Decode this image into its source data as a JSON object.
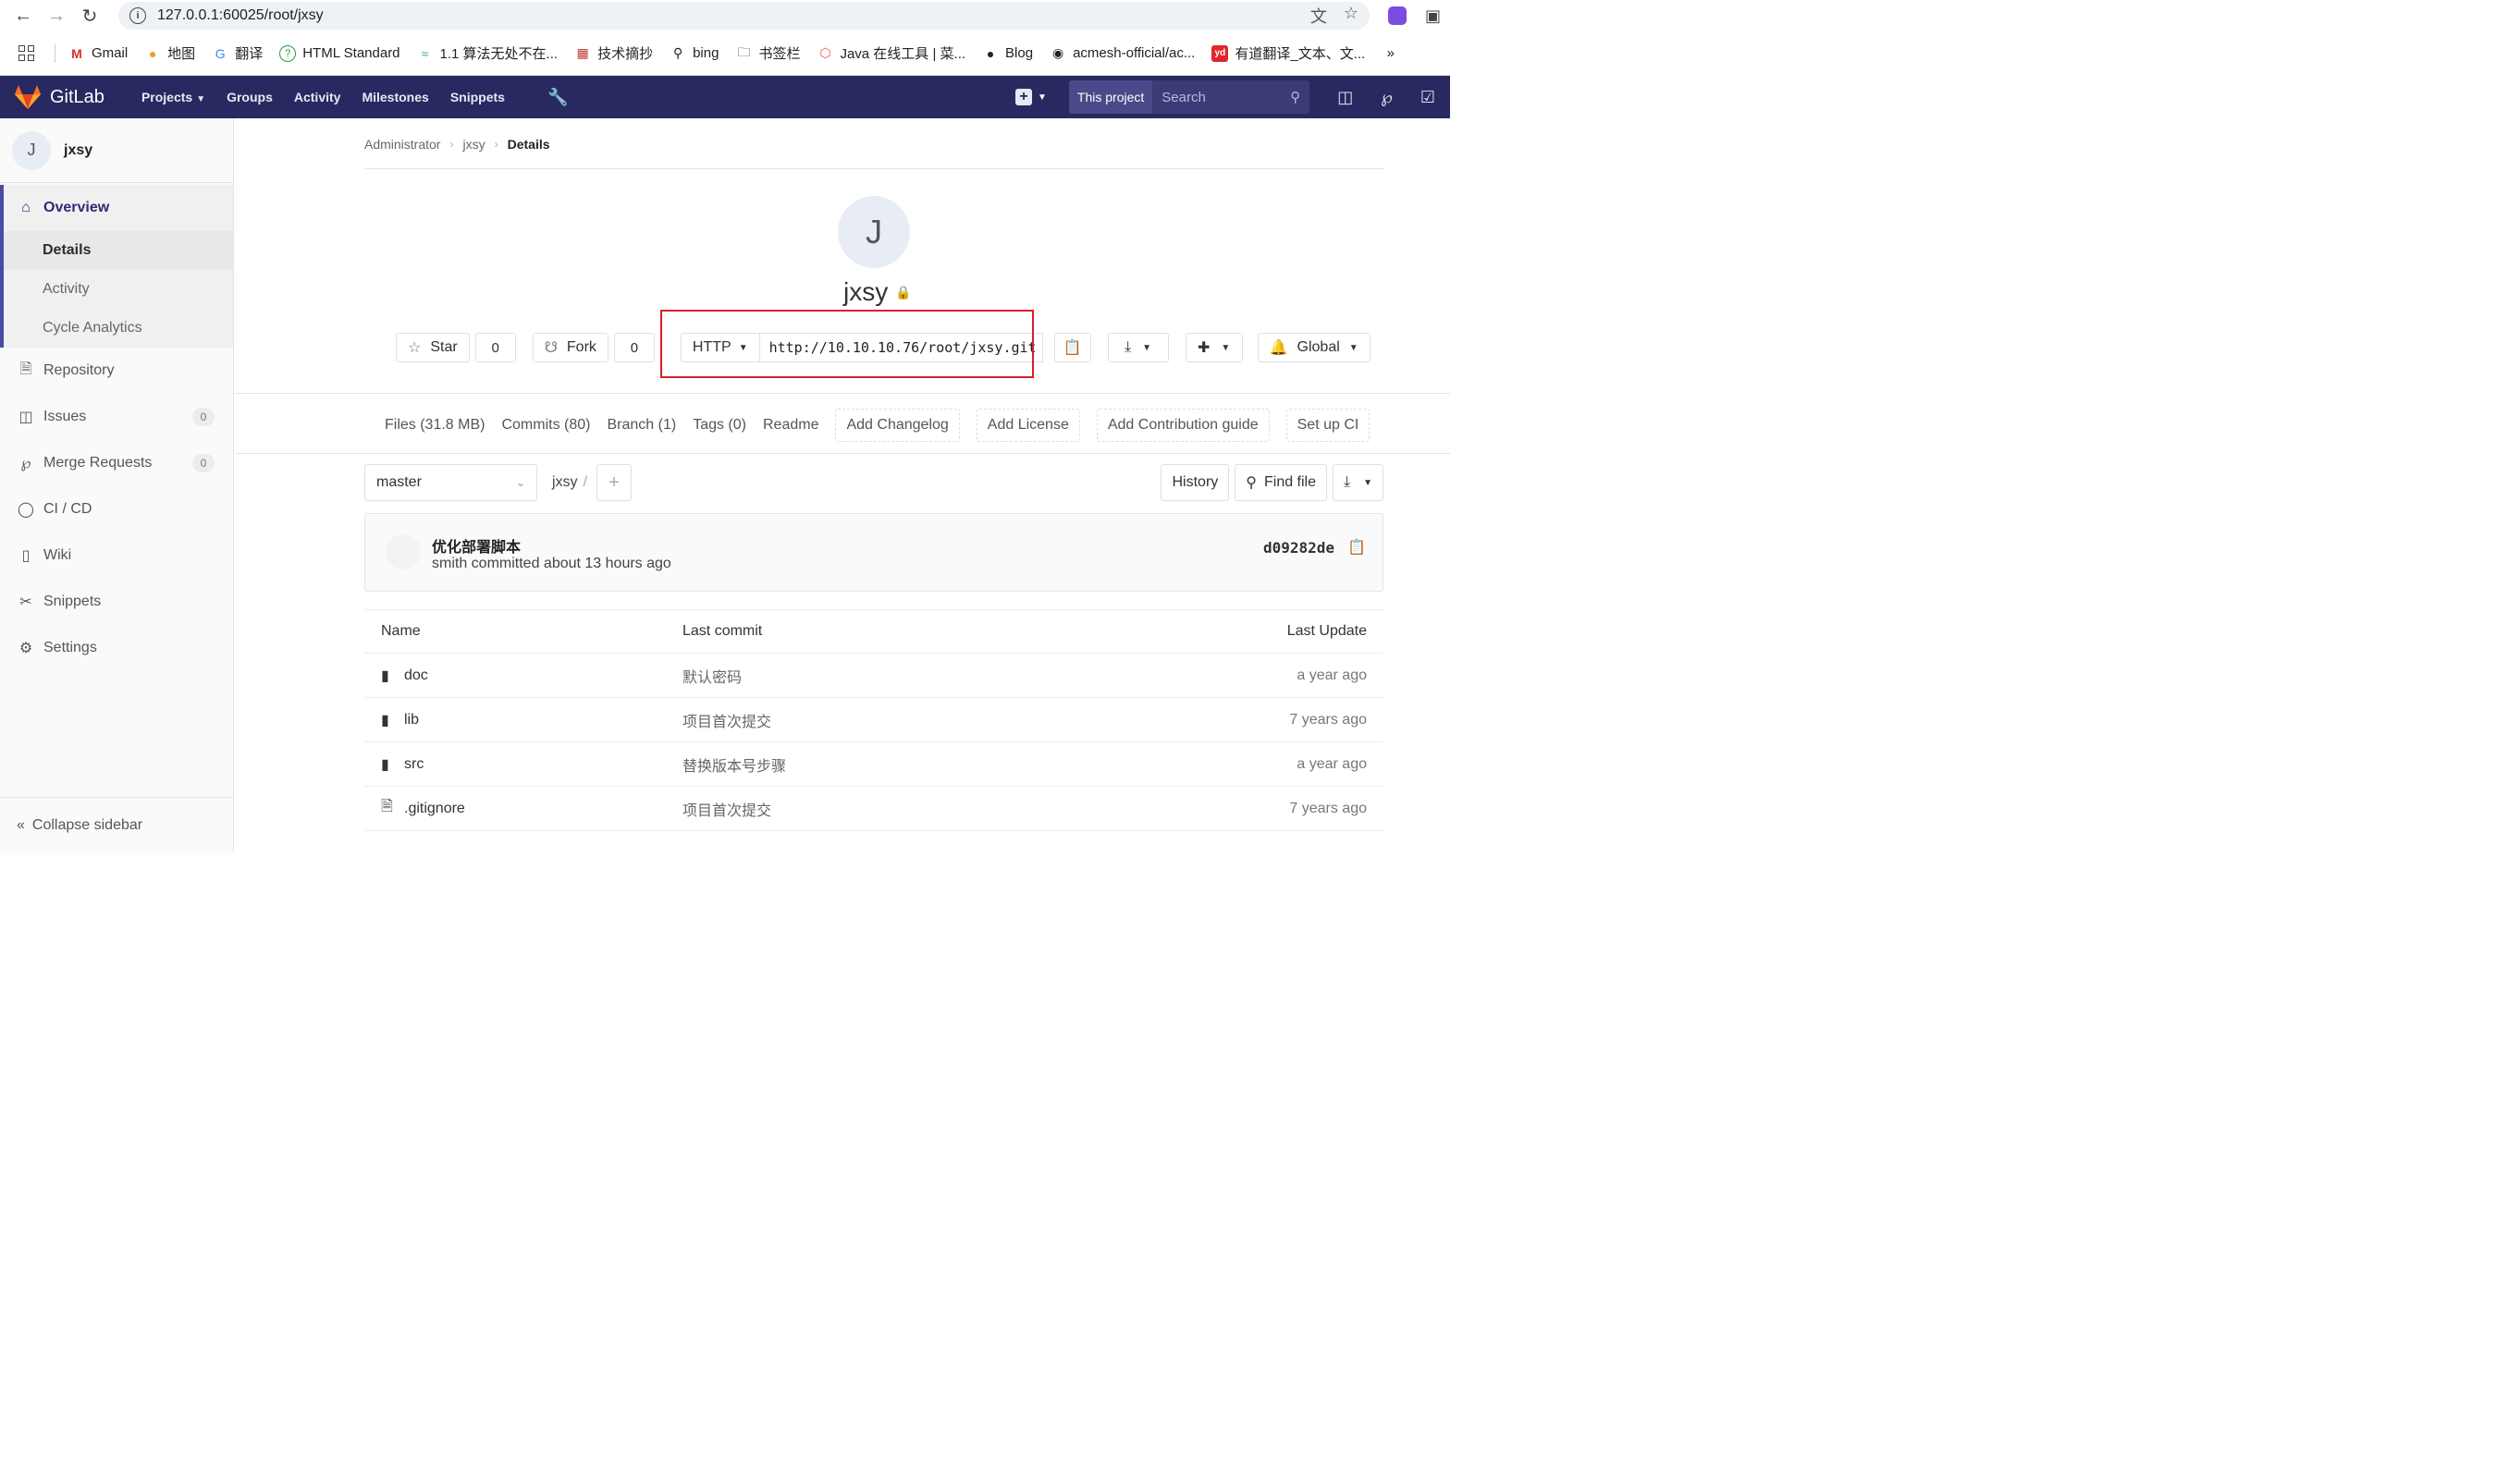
{
  "browser": {
    "url": "127.0.0.1:60025/root/jxsy",
    "bookmarks": [
      {
        "label": "Gmail",
        "icon": "gmail-icon"
      },
      {
        "label": "地图",
        "icon": "maps-icon"
      },
      {
        "label": "翻译",
        "icon": "translate-icon"
      },
      {
        "label": "HTML Standard",
        "icon": "help-circle-icon"
      },
      {
        "label": "1.1 算法无处不在...",
        "icon": "chart-icon"
      },
      {
        "label": "技术摘抄",
        "icon": "book-icon"
      },
      {
        "label": "bing",
        "icon": "search-icon"
      },
      {
        "label": "书签栏",
        "icon": "folder-icon"
      },
      {
        "label": "Java 在线工具 | 菜...",
        "icon": "cube-icon"
      },
      {
        "label": "Blog",
        "icon": "globe-icon"
      },
      {
        "label": "acmesh-official/ac...",
        "icon": "github-icon"
      },
      {
        "label": "有道翻译_文本、文...",
        "icon": "youdao-icon"
      }
    ]
  },
  "gitlab": {
    "brand": "GitLab",
    "nav": {
      "projects": "Projects",
      "groups": "Groups",
      "activity": "Activity",
      "milestones": "Milestones",
      "snippets": "Snippets"
    },
    "this_project": "This project",
    "search_placeholder": "Search"
  },
  "sidebar": {
    "project_initial": "J",
    "project_name": "jxsy",
    "overview": "Overview",
    "sub": {
      "details": "Details",
      "activity": "Activity",
      "cycle": "Cycle Analytics"
    },
    "items": {
      "repository": "Repository",
      "issues": "Issues",
      "issues_count": "0",
      "merge_requests": "Merge Requests",
      "merge_requests_count": "0",
      "cicd": "CI / CD",
      "wiki": "Wiki",
      "snippets": "Snippets",
      "settings": "Settings"
    },
    "collapse": "Collapse sidebar"
  },
  "breadcrumb": {
    "a": "Administrator",
    "b": "jxsy",
    "c": "Details"
  },
  "project": {
    "initial": "J",
    "name": "jxsy",
    "star": "Star",
    "star_count": "0",
    "fork": "Fork",
    "fork_count": "0",
    "protocol": "HTTP",
    "clone_url": "http://10.10.10.76/root/jxsy.git",
    "notification": "Global"
  },
  "tabs": {
    "files": "Files (31.8 MB)",
    "commits": "Commits (80)",
    "branch": "Branch (1)",
    "tags": "Tags (0)",
    "readme": "Readme",
    "changelog": "Add Changelog",
    "license": "Add License",
    "contrib": "Add Contribution guide",
    "ci": "Set up CI"
  },
  "repo": {
    "branch": "master",
    "path": "jxsy",
    "history": "History",
    "find_file": "Find file"
  },
  "commit": {
    "title": "优化部署脚本",
    "meta": "smith committed about 13 hours ago",
    "sha": "d09282de"
  },
  "table": {
    "headers": {
      "name": "Name",
      "last_commit": "Last commit",
      "last_update": "Last Update"
    },
    "rows": [
      {
        "name": "doc",
        "type": "folder",
        "commit": "默认密码",
        "updated": "a year ago"
      },
      {
        "name": "lib",
        "type": "folder",
        "commit": "项目首次提交",
        "updated": "7 years ago"
      },
      {
        "name": "src",
        "type": "folder",
        "commit": "替换版本号步骤",
        "updated": "a year ago"
      },
      {
        "name": ".gitignore",
        "type": "file",
        "commit": "项目首次提交",
        "updated": "7 years ago"
      }
    ]
  },
  "colors": {
    "header": "#292961",
    "accent": "#2d2d77",
    "highlight_box": "#d9202a"
  }
}
